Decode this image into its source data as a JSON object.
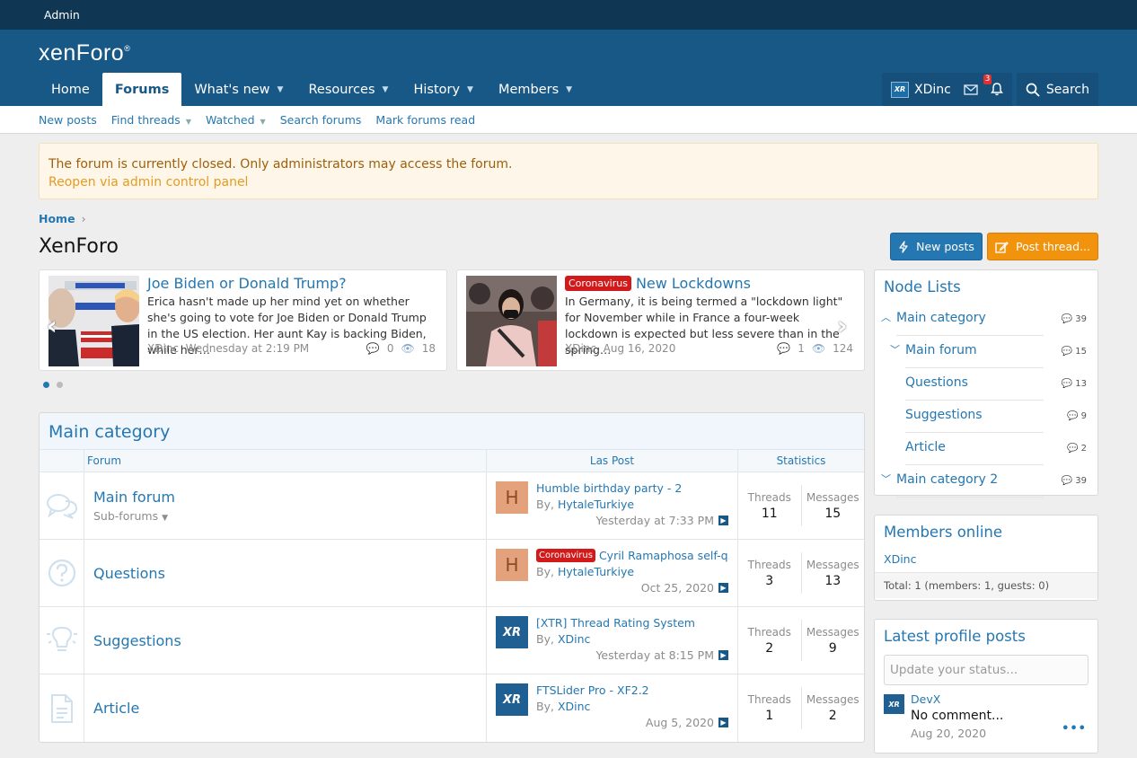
{
  "topbar": {
    "admin": "Admin"
  },
  "header": {
    "logo": "xenForo",
    "logo_mark": "®",
    "tabs": [
      {
        "label": "Home",
        "active": false,
        "caret": false
      },
      {
        "label": "Forums",
        "active": true,
        "caret": false
      },
      {
        "label": "What's new",
        "active": false,
        "caret": true
      },
      {
        "label": "Resources",
        "active": false,
        "caret": true
      },
      {
        "label": "History",
        "active": false,
        "caret": true
      },
      {
        "label": "Members",
        "active": false,
        "caret": true
      }
    ],
    "user": {
      "name": "XDinc",
      "avatar_text": "XR"
    },
    "alerts_count": "3",
    "search_label": "Search"
  },
  "subnav": {
    "new_posts": "New posts",
    "find_threads": "Find threads",
    "watched": "Watched",
    "search_forums": "Search forums",
    "mark_read": "Mark forums read"
  },
  "notice": {
    "text": "The forum is currently closed. Only administrators may access the forum.",
    "link": "Reopen via admin control panel"
  },
  "breadcrumb": {
    "home": "Home"
  },
  "page": {
    "title": "XenForo",
    "new_posts_button": "New posts",
    "post_thread_button": "Post thread..."
  },
  "slider": [
    {
      "prefix": "",
      "title": "Joe Biden or Donald Trump?",
      "text": "Erica hasn't made up her mind yet on whether she's going to vote for Joe Biden or Donald Trump in the US election. Her aunt Kay is backing Biden, while her…",
      "author": "XDinc",
      "date": "Wednesday at 2:19 PM",
      "replies": "0",
      "views": "18"
    },
    {
      "prefix": "Coronavirus",
      "title": "New Lockdowns",
      "text": "In Germany, it is being termed a \"lockdown light\" for November while in France a four-week lockdown is expected but less severe than in the spring…",
      "author": "XDinc",
      "date": "Aug 16, 2020",
      "replies": "1",
      "views": "124"
    }
  ],
  "forum_block": {
    "title": "Main category",
    "columns": {
      "forum": "Forum",
      "last_post": "Las Post",
      "statistics": "Statistics"
    },
    "stat_labels": {
      "threads": "Threads",
      "messages": "Messages"
    },
    "rows": [
      {
        "title": "Main forum",
        "sub": "Sub-forums",
        "icon": "chat-bubbles-icon",
        "last_avatar": "H",
        "last_prefix": "",
        "last_title": "Humble birthday party - 2",
        "last_by_prefix": "By,",
        "last_user": "HytaleTurkiye",
        "last_date": "Yesterday at 7:33 PM",
        "threads": "11",
        "messages": "15"
      },
      {
        "title": "Questions",
        "sub": "",
        "icon": "question-icon",
        "last_avatar": "H",
        "last_prefix": "Coronavirus",
        "last_title": "Cyril Ramaphosa self-q...",
        "last_by_prefix": "By,",
        "last_user": "HytaleTurkiye",
        "last_date": "Oct 25, 2020",
        "threads": "3",
        "messages": "13"
      },
      {
        "title": "Suggestions",
        "sub": "",
        "icon": "lightbulb-icon",
        "last_avatar": "XR",
        "last_prefix": "",
        "last_title": "[XTR] Thread Rating System",
        "last_by_prefix": "By,",
        "last_user": "XDinc",
        "last_date": "Yesterday at 8:15 PM",
        "threads": "2",
        "messages": "9"
      },
      {
        "title": "Article",
        "sub": "",
        "icon": "document-icon",
        "last_avatar": "XR",
        "last_prefix": "",
        "last_title": "FTSLider Pro - XF2.2",
        "last_by_prefix": "By,",
        "last_user": "XDinc",
        "last_date": "Aug 5, 2020",
        "threads": "1",
        "messages": "2"
      }
    ]
  },
  "sidebar": {
    "node_lists": {
      "title": "Node Lists",
      "items": [
        {
          "label": "Main category",
          "count": "39"
        },
        {
          "label": "Main forum",
          "count": "15"
        },
        {
          "label": "Questions",
          "count": "13"
        },
        {
          "label": "Suggestions",
          "count": "9"
        },
        {
          "label": "Article",
          "count": "2"
        },
        {
          "label": "Main category 2",
          "count": "39"
        }
      ]
    },
    "members_online": {
      "title": "Members online",
      "user": "XDinc",
      "total": "Total: 1 (members: 1, guests: 0)"
    },
    "profile_posts": {
      "title": "Latest profile posts",
      "placeholder": "Update your status...",
      "post": {
        "avatar": "XR",
        "name": "DevX",
        "text": "No comment...",
        "date": "Aug 20, 2020",
        "more": "•••"
      }
    }
  },
  "colors": {
    "header": "#185886",
    "topbar": "#0f3652",
    "link": "#2577b1",
    "accent": "#f2930d",
    "prefix": "#d21a1a"
  }
}
